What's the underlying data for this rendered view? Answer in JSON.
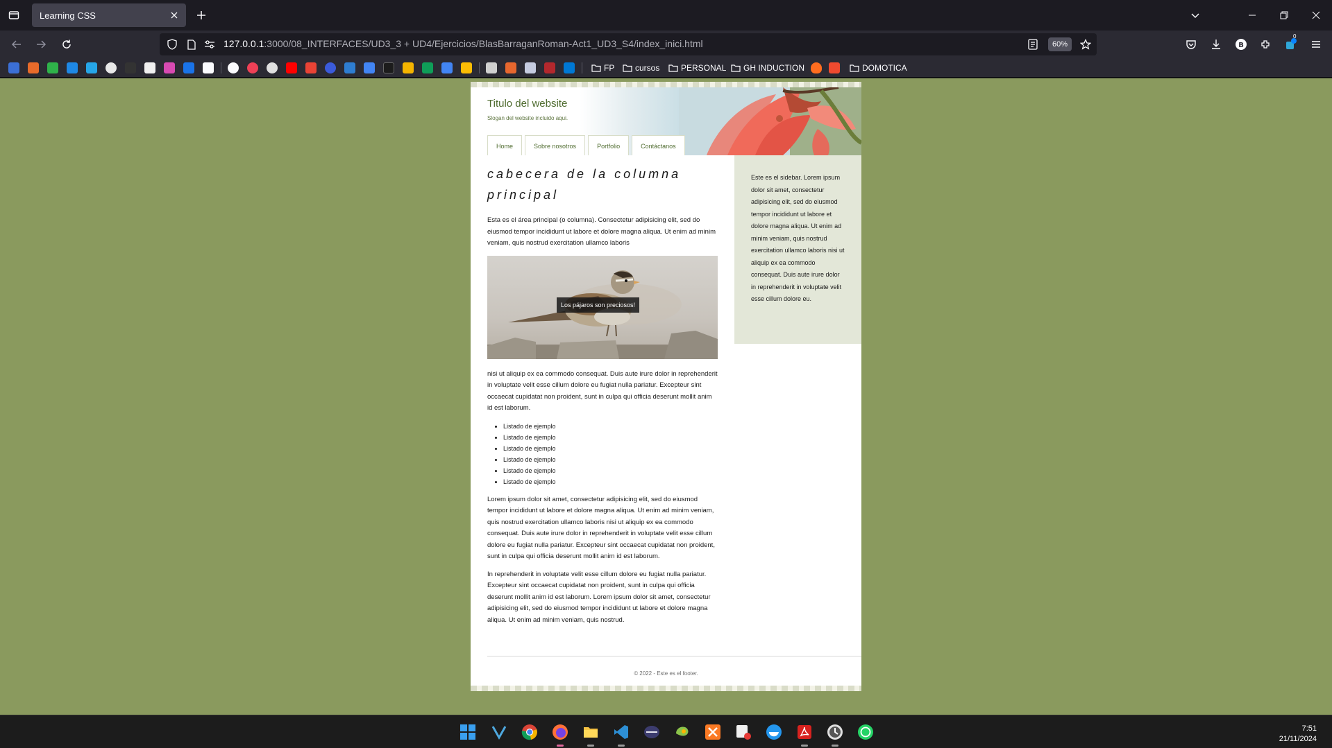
{
  "browser": {
    "tab_title": "Learning CSS",
    "url_host": "127.0.0.1",
    "url_path": ":3000/08_INTERFACES/UD3_3 + UD4/Ejercicios/BlasBarraganRoman-Act1_UD3_S4/index_inici.html",
    "zoom": "60%",
    "extensions_badge": "0",
    "bookmark_folders": [
      "FP",
      "cursos",
      "PERSONAL",
      "GH INDUCTION",
      "DOMOTICA"
    ]
  },
  "page": {
    "site_title": "Titulo del website",
    "site_slogan": "Slogan del website incluido aqui.",
    "menu": [
      "Home",
      "Sobre nosotros",
      "Portfolio",
      "Contáctanos"
    ],
    "main_heading": "cabecera de la columna principal",
    "intro": "Esta es el área principal (o columna). Consectetur adipisicing elit, sed do eiusmod tempor incididunt ut labore et dolore magna aliqua. Ut enim ad minim veniam, quis nostrud exercitation ullamco laboris",
    "image_caption": "Los pájaros son preciosos!",
    "after_image": "nisi ut aliquip ex ea commodo consequat. Duis aute irure dolor in reprehenderit in voluptate velit esse cillum dolore eu fugiat nulla pariatur. Excepteur sint occaecat cupidatat non proident, sunt in culpa qui officia deserunt mollit anim id est laborum.",
    "list": [
      "Listado de ejemplo",
      "Listado de ejemplo",
      "Listado de ejemplo",
      "Listado de ejemplo",
      "Listado de ejemplo",
      "Listado de ejemplo"
    ],
    "para2": "Lorem ipsum dolor sit amet, consectetur adipisicing elit, sed do eiusmod tempor incididunt ut labore et dolore magna aliqua. Ut enim ad minim veniam, quis nostrud exercitation ullamco laboris nisi ut aliquip ex ea commodo consequat. Duis aute irure dolor in reprehenderit in voluptate velit esse cillum dolore eu fugiat nulla pariatur. Excepteur sint occaecat cupidatat non proident, sunt in culpa qui officia deserunt mollit anim id est laborum.",
    "para3": "In reprehenderit in voluptate velit esse cillum dolore eu fugiat nulla pariatur. Excepteur sint occaecat cupidatat non proident, sunt in culpa qui officia deserunt mollit anim id est laborum. Lorem ipsum dolor sit amet, consectetur adipisicing elit, sed do eiusmod tempor incididunt ut labore et dolore magna aliqua. Ut enim ad minim veniam, quis nostrud.",
    "sidebar": "Este es el sidebar. Lorem ipsum dolor sit amet, consectetur adipisicing elit, sed do eiusmod tempor incididunt ut labore et dolore magna aliqua. Ut enim ad minim veniam, quis nostrud exercitation ullamco laboris nisi ut aliquip ex ea commodo consequat. Duis aute irure dolor in reprehenderit in voluptate velit esse cillum dolore eu.",
    "footer": "© 2022 - Este es el footer."
  },
  "taskbar": {
    "time": "7:51",
    "date": "21/11/2024"
  },
  "colors": {
    "page_background": "#8a9a5e",
    "accent_green": "#4e6b2e",
    "sidebar_bg": "#e3e7d8",
    "chrome_dark": "#1c1b22",
    "chrome_mid": "#2b2a33"
  },
  "icons": [
    "tab-list-icon",
    "close-icon",
    "plus-icon",
    "chevron-down-icon",
    "minimize-icon",
    "restore-icon",
    "back-icon",
    "forward-icon",
    "reload-icon",
    "shield-icon",
    "page-icon",
    "permissions-icon",
    "reader-icon",
    "star-icon",
    "pocket-icon",
    "download-icon",
    "account-icon",
    "extensions-icon",
    "menu-icon",
    "folder-icon",
    "windows-start-icon"
  ]
}
